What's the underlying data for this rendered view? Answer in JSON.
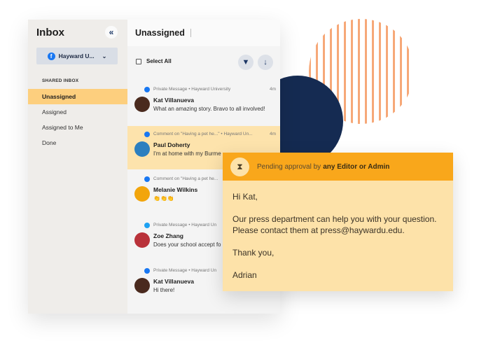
{
  "sidebar": {
    "title": "Inbox",
    "collapse_icon": "«",
    "account": {
      "label": "Hayward U...",
      "network": "facebook"
    },
    "section_label": "SHARED INBOX",
    "items": [
      {
        "label": "Unassigned",
        "active": true
      },
      {
        "label": "Assigned",
        "active": false
      },
      {
        "label": "Assigned to Me",
        "active": false
      },
      {
        "label": "Done",
        "active": false
      }
    ]
  },
  "list": {
    "title": "Unassigned",
    "select_all_label": "Select All",
    "messages": [
      {
        "channel": "facebook-messenger",
        "meta": "Private Message  •  Hayward University",
        "time": "4m",
        "name": "Kat Villanueva",
        "text": "What an amazing story. Bravo to all involved!",
        "avatar_color": "#4a2a1e"
      },
      {
        "channel": "facebook-messenger",
        "meta": "Comment on \"Having a pet he...\"  •  Hayward Un...",
        "time": "4m",
        "name": "Paul Doherty",
        "text": "I'm at home with my Burme",
        "avatar_color": "#2c7fbf",
        "active": true
      },
      {
        "channel": "facebook-messenger",
        "meta": "Comment on \"Having a pet he...",
        "time": "",
        "name": "Melanie Wilkins",
        "text": "👏👏👏",
        "avatar_color": "#f2a50c"
      },
      {
        "channel": "twitter",
        "meta": "Private Message  •  Hayward Un",
        "time": "",
        "name": "Zoe Zhang",
        "text": "Does your school accept fo",
        "avatar_color": "#b9323a"
      },
      {
        "channel": "facebook-messenger",
        "meta": "Private Message  •  Hayward Un",
        "time": "",
        "name": "Kat Villanueva",
        "text": "Hi there!",
        "avatar_color": "#4a2a1e"
      }
    ]
  },
  "approval_card": {
    "status_prefix": "Pending approval by",
    "status_bold": "any Editor or Admin",
    "greeting": "Hi Kat,",
    "body_line1": "Our press department can help you with your question.",
    "body_line2": "Please contact them at press@haywardu.edu.",
    "closing": "Thank you,",
    "signature": "Adrian"
  },
  "colors": {
    "accent": "#f9a71b",
    "active_row": "#fde3ac",
    "navy": "#152b52",
    "stripes": "#f6a878"
  }
}
